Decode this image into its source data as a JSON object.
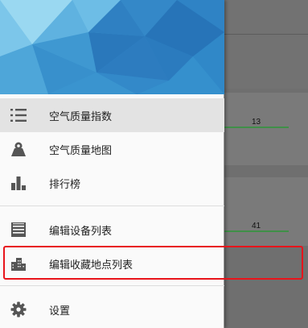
{
  "background": {
    "values": [
      "13",
      "41"
    ]
  },
  "menu": {
    "items": [
      {
        "label": "空气质量指数",
        "icon": "list-icon",
        "active": true
      },
      {
        "label": "空气质量地图",
        "icon": "map-icon"
      },
      {
        "label": "排行榜",
        "icon": "bar-chart-icon"
      },
      {
        "label": "编辑设备列表",
        "icon": "device-list-icon"
      },
      {
        "label": "编辑收藏地点列表",
        "icon": "city-icon"
      },
      {
        "label": "设置",
        "icon": "gear-icon"
      }
    ]
  },
  "colors": {
    "accent": "#e8141b",
    "header": "#3e9fd6",
    "active_bg": "#e3e3e3",
    "bar_green": "#4caf50"
  }
}
